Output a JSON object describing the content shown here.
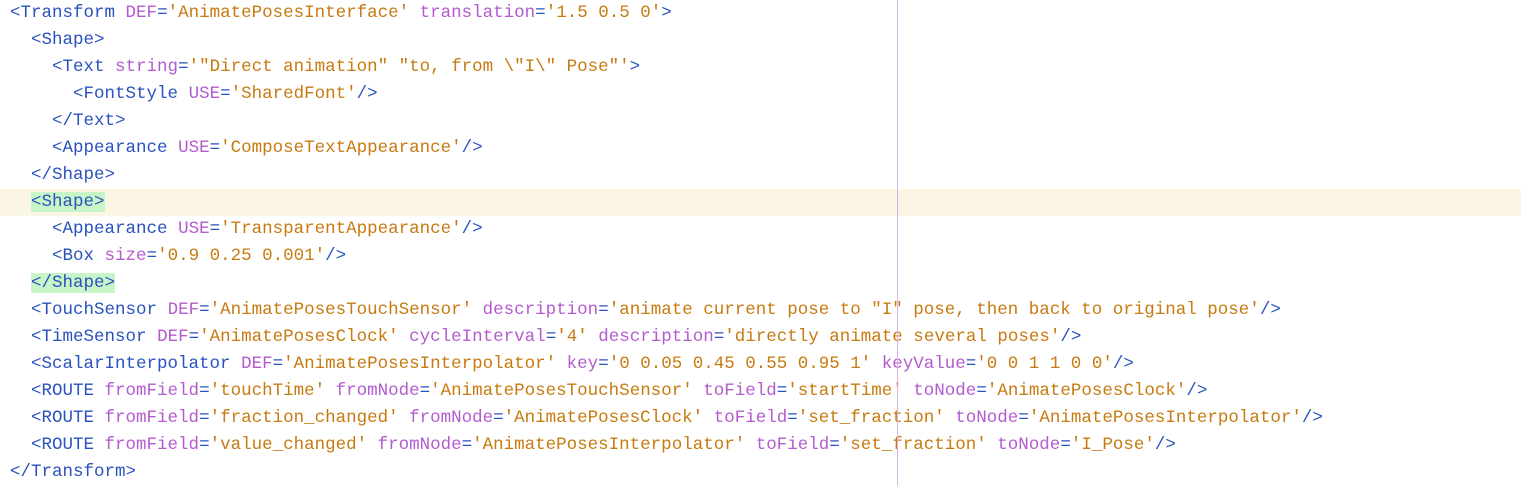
{
  "editor": {
    "colors": {
      "tag": "#2a52be",
      "attr": "#b45bcf",
      "value": "#c77a10",
      "punct": "#2a52be",
      "current_line_bg": "#fbf6e4",
      "bracket_match_bg": "#c8f5c8",
      "ruler": "#d9b3e6"
    },
    "current_line": 7,
    "lines": [
      [
        {
          "t": "<Transform",
          "c": "tag"
        },
        {
          "t": " ",
          "c": "punct"
        },
        {
          "t": "DEF",
          "c": "attr"
        },
        {
          "t": "=",
          "c": "punct"
        },
        {
          "t": "'AnimatePosesInterface'",
          "c": "value"
        },
        {
          "t": " ",
          "c": "punct"
        },
        {
          "t": "translation",
          "c": "attr"
        },
        {
          "t": "=",
          "c": "punct"
        },
        {
          "t": "'1.5 0.5 0'",
          "c": "value"
        },
        {
          "t": ">",
          "c": "tag"
        }
      ],
      [
        {
          "t": "  ",
          "c": "punct"
        },
        {
          "t": "<Shape>",
          "c": "tag"
        }
      ],
      [
        {
          "t": "    ",
          "c": "punct"
        },
        {
          "t": "<Text",
          "c": "tag"
        },
        {
          "t": " ",
          "c": "punct"
        },
        {
          "t": "string",
          "c": "attr"
        },
        {
          "t": "=",
          "c": "punct"
        },
        {
          "t": "'\"Direct animation\" \"to, from \\\"I\\\" Pose\"'",
          "c": "value"
        },
        {
          "t": ">",
          "c": "tag"
        }
      ],
      [
        {
          "t": "      ",
          "c": "punct"
        },
        {
          "t": "<FontStyle",
          "c": "tag"
        },
        {
          "t": " ",
          "c": "punct"
        },
        {
          "t": "USE",
          "c": "attr"
        },
        {
          "t": "=",
          "c": "punct"
        },
        {
          "t": "'SharedFont'",
          "c": "value"
        },
        {
          "t": "/>",
          "c": "tag"
        }
      ],
      [
        {
          "t": "    ",
          "c": "punct"
        },
        {
          "t": "</Text>",
          "c": "tag"
        }
      ],
      [
        {
          "t": "    ",
          "c": "punct"
        },
        {
          "t": "<Appearance",
          "c": "tag"
        },
        {
          "t": " ",
          "c": "punct"
        },
        {
          "t": "USE",
          "c": "attr"
        },
        {
          "t": "=",
          "c": "punct"
        },
        {
          "t": "'ComposeTextAppearance'",
          "c": "value"
        },
        {
          "t": "/>",
          "c": "tag"
        }
      ],
      [
        {
          "t": "  ",
          "c": "punct"
        },
        {
          "t": "</Shape>",
          "c": "tag"
        }
      ],
      [
        {
          "t": "  ",
          "c": "punct"
        },
        {
          "t": "<Shape>",
          "c": "tag",
          "m": 1
        }
      ],
      [
        {
          "t": "    ",
          "c": "punct"
        },
        {
          "t": "<Appearance",
          "c": "tag"
        },
        {
          "t": " ",
          "c": "punct"
        },
        {
          "t": "USE",
          "c": "attr"
        },
        {
          "t": "=",
          "c": "punct"
        },
        {
          "t": "'TransparentAppearance'",
          "c": "value"
        },
        {
          "t": "/>",
          "c": "tag"
        }
      ],
      [
        {
          "t": "    ",
          "c": "punct"
        },
        {
          "t": "<Box",
          "c": "tag"
        },
        {
          "t": " ",
          "c": "punct"
        },
        {
          "t": "size",
          "c": "attr"
        },
        {
          "t": "=",
          "c": "punct"
        },
        {
          "t": "'0.9 0.25 0.001'",
          "c": "value"
        },
        {
          "t": "/>",
          "c": "tag"
        }
      ],
      [
        {
          "t": "  ",
          "c": "punct"
        },
        {
          "t": "</Shape>",
          "c": "tag",
          "m": 1
        }
      ],
      [
        {
          "t": "  ",
          "c": "punct"
        },
        {
          "t": "<TouchSensor",
          "c": "tag"
        },
        {
          "t": " ",
          "c": "punct"
        },
        {
          "t": "DEF",
          "c": "attr"
        },
        {
          "t": "=",
          "c": "punct"
        },
        {
          "t": "'AnimatePosesTouchSensor'",
          "c": "value"
        },
        {
          "t": " ",
          "c": "punct"
        },
        {
          "t": "description",
          "c": "attr"
        },
        {
          "t": "=",
          "c": "punct"
        },
        {
          "t": "'animate current pose to \"I\" pose, then back to original pose'",
          "c": "value"
        },
        {
          "t": "/>",
          "c": "tag"
        }
      ],
      [
        {
          "t": "  ",
          "c": "punct"
        },
        {
          "t": "<TimeSensor",
          "c": "tag"
        },
        {
          "t": " ",
          "c": "punct"
        },
        {
          "t": "DEF",
          "c": "attr"
        },
        {
          "t": "=",
          "c": "punct"
        },
        {
          "t": "'AnimatePosesClock'",
          "c": "value"
        },
        {
          "t": " ",
          "c": "punct"
        },
        {
          "t": "cycleInterval",
          "c": "attr"
        },
        {
          "t": "=",
          "c": "punct"
        },
        {
          "t": "'4'",
          "c": "value"
        },
        {
          "t": " ",
          "c": "punct"
        },
        {
          "t": "description",
          "c": "attr"
        },
        {
          "t": "=",
          "c": "punct"
        },
        {
          "t": "'directly animate several poses'",
          "c": "value"
        },
        {
          "t": "/>",
          "c": "tag"
        }
      ],
      [
        {
          "t": "  ",
          "c": "punct"
        },
        {
          "t": "<ScalarInterpolator",
          "c": "tag"
        },
        {
          "t": " ",
          "c": "punct"
        },
        {
          "t": "DEF",
          "c": "attr"
        },
        {
          "t": "=",
          "c": "punct"
        },
        {
          "t": "'AnimatePosesInterpolator'",
          "c": "value"
        },
        {
          "t": " ",
          "c": "punct"
        },
        {
          "t": "key",
          "c": "attr"
        },
        {
          "t": "=",
          "c": "punct"
        },
        {
          "t": "'0 0.05 0.45 0.55 0.95 1'",
          "c": "value"
        },
        {
          "t": " ",
          "c": "punct"
        },
        {
          "t": "keyValue",
          "c": "attr"
        },
        {
          "t": "=",
          "c": "punct"
        },
        {
          "t": "'0 0 1 1 0 0'",
          "c": "value"
        },
        {
          "t": "/>",
          "c": "tag"
        }
      ],
      [
        {
          "t": "  ",
          "c": "punct"
        },
        {
          "t": "<ROUTE",
          "c": "tag"
        },
        {
          "t": " ",
          "c": "punct"
        },
        {
          "t": "fromField",
          "c": "attr"
        },
        {
          "t": "=",
          "c": "punct"
        },
        {
          "t": "'touchTime'",
          "c": "value"
        },
        {
          "t": " ",
          "c": "punct"
        },
        {
          "t": "fromNode",
          "c": "attr"
        },
        {
          "t": "=",
          "c": "punct"
        },
        {
          "t": "'AnimatePosesTouchSensor'",
          "c": "value"
        },
        {
          "t": " ",
          "c": "punct"
        },
        {
          "t": "toField",
          "c": "attr"
        },
        {
          "t": "=",
          "c": "punct"
        },
        {
          "t": "'startTime'",
          "c": "value"
        },
        {
          "t": " ",
          "c": "punct"
        },
        {
          "t": "toNode",
          "c": "attr"
        },
        {
          "t": "=",
          "c": "punct"
        },
        {
          "t": "'AnimatePosesClock'",
          "c": "value"
        },
        {
          "t": "/>",
          "c": "tag"
        }
      ],
      [
        {
          "t": "  ",
          "c": "punct"
        },
        {
          "t": "<ROUTE",
          "c": "tag"
        },
        {
          "t": " ",
          "c": "punct"
        },
        {
          "t": "fromField",
          "c": "attr"
        },
        {
          "t": "=",
          "c": "punct"
        },
        {
          "t": "'fraction_changed'",
          "c": "value"
        },
        {
          "t": " ",
          "c": "punct"
        },
        {
          "t": "fromNode",
          "c": "attr"
        },
        {
          "t": "=",
          "c": "punct"
        },
        {
          "t": "'AnimatePosesClock'",
          "c": "value"
        },
        {
          "t": " ",
          "c": "punct"
        },
        {
          "t": "toField",
          "c": "attr"
        },
        {
          "t": "=",
          "c": "punct"
        },
        {
          "t": "'set_fraction'",
          "c": "value"
        },
        {
          "t": " ",
          "c": "punct"
        },
        {
          "t": "toNode",
          "c": "attr"
        },
        {
          "t": "=",
          "c": "punct"
        },
        {
          "t": "'AnimatePosesInterpolator'",
          "c": "value"
        },
        {
          "t": "/>",
          "c": "tag"
        }
      ],
      [
        {
          "t": "  ",
          "c": "punct"
        },
        {
          "t": "<ROUTE",
          "c": "tag"
        },
        {
          "t": " ",
          "c": "punct"
        },
        {
          "t": "fromField",
          "c": "attr"
        },
        {
          "t": "=",
          "c": "punct"
        },
        {
          "t": "'value_changed'",
          "c": "value"
        },
        {
          "t": " ",
          "c": "punct"
        },
        {
          "t": "fromNode",
          "c": "attr"
        },
        {
          "t": "=",
          "c": "punct"
        },
        {
          "t": "'AnimatePosesInterpolator'",
          "c": "value"
        },
        {
          "t": " ",
          "c": "punct"
        },
        {
          "t": "toField",
          "c": "attr"
        },
        {
          "t": "=",
          "c": "punct"
        },
        {
          "t": "'set_fraction'",
          "c": "value"
        },
        {
          "t": " ",
          "c": "punct"
        },
        {
          "t": "toNode",
          "c": "attr"
        },
        {
          "t": "=",
          "c": "punct"
        },
        {
          "t": "'I_Pose'",
          "c": "value"
        },
        {
          "t": "/>",
          "c": "tag"
        }
      ],
      [
        {
          "t": "</Transform>",
          "c": "tag"
        }
      ]
    ]
  }
}
